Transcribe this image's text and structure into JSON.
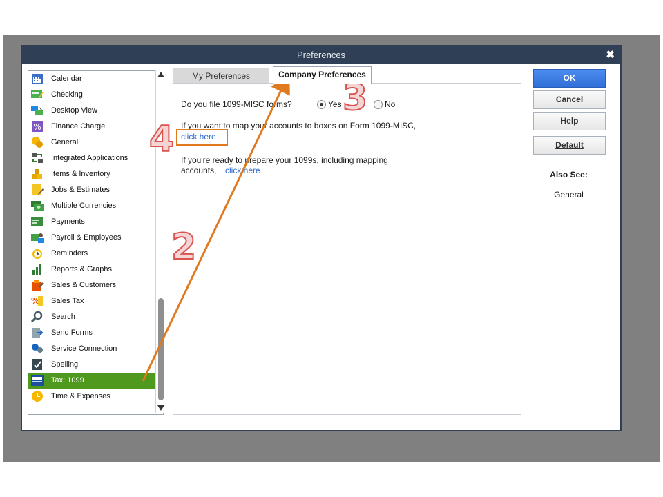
{
  "window": {
    "title": "Preferences",
    "close": "✖"
  },
  "sidebar": {
    "items": [
      {
        "label": "Calendar",
        "icon": "calendar-icon",
        "selected": false
      },
      {
        "label": "Checking",
        "icon": "checking-icon",
        "selected": false
      },
      {
        "label": "Desktop View",
        "icon": "desktop-view-icon",
        "selected": false
      },
      {
        "label": "Finance Charge",
        "icon": "finance-charge-icon",
        "selected": false
      },
      {
        "label": "General",
        "icon": "general-icon",
        "selected": false
      },
      {
        "label": "Integrated Applications",
        "icon": "integrated-applications-icon",
        "selected": false
      },
      {
        "label": "Items & Inventory",
        "icon": "items-inventory-icon",
        "selected": false
      },
      {
        "label": "Jobs & Estimates",
        "icon": "jobs-estimates-icon",
        "selected": false
      },
      {
        "label": "Multiple Currencies",
        "icon": "multiple-currencies-icon",
        "selected": false
      },
      {
        "label": "Payments",
        "icon": "payments-icon",
        "selected": false
      },
      {
        "label": "Payroll & Employees",
        "icon": "payroll-employees-icon",
        "selected": false
      },
      {
        "label": "Reminders",
        "icon": "reminders-icon",
        "selected": false
      },
      {
        "label": "Reports & Graphs",
        "icon": "reports-graphs-icon",
        "selected": false
      },
      {
        "label": "Sales & Customers",
        "icon": "sales-customers-icon",
        "selected": false
      },
      {
        "label": "Sales Tax",
        "icon": "sales-tax-icon",
        "selected": false
      },
      {
        "label": "Search",
        "icon": "search-icon",
        "selected": false
      },
      {
        "label": "Send Forms",
        "icon": "send-forms-icon",
        "selected": false
      },
      {
        "label": "Service Connection",
        "icon": "service-connection-icon",
        "selected": false
      },
      {
        "label": "Spelling",
        "icon": "spelling-icon",
        "selected": false
      },
      {
        "label": "Tax: 1099",
        "icon": "tax-1099-icon",
        "selected": true
      },
      {
        "label": "Time & Expenses",
        "icon": "time-expenses-icon",
        "selected": false
      }
    ]
  },
  "tabs": [
    {
      "label": "My Preferences",
      "active": false
    },
    {
      "label": "Company Preferences",
      "active": true
    }
  ],
  "content": {
    "question": "Do you file 1099-MISC forms?",
    "yes_label": "Yes",
    "no_label": "No",
    "selected": "Yes",
    "map_text": "If you want to map your accounts to boxes on Form 1099-MISC,",
    "map_link": "click here",
    "ready_text": "If you're ready to prepare your 1099s, including mapping accounts,",
    "ready_link": "click here"
  },
  "buttons": {
    "ok": "OK",
    "cancel": "Cancel",
    "help": "Help",
    "default": "Default"
  },
  "also_see": {
    "heading": "Also See:",
    "link": "General"
  },
  "annotations": {
    "step2": "2",
    "step3": "3",
    "step4": "4",
    "arrow_color": "#e07a1f"
  },
  "colors": {
    "selected_item": "#4f9a1e",
    "ok_button": "#2f6fd8",
    "link": "#2a6ad0",
    "title_bar": "#2f3f55"
  }
}
